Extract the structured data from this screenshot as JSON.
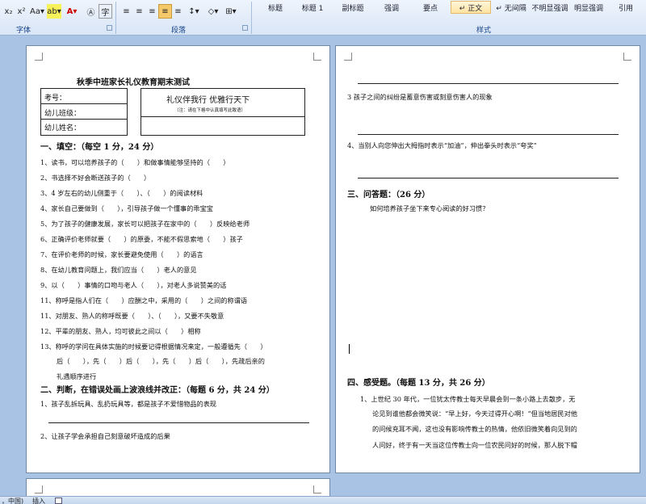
{
  "ribbon": {
    "font_group": {
      "label": "字体",
      "tools": [
        "x₂",
        "x²",
        "Aa▾",
        "ab▾",
        "A▾",
        "Ⓐ",
        "字"
      ]
    },
    "paragraph_group": {
      "label": "段落",
      "tools": [
        "≡",
        "≡",
        "≡",
        "≡",
        "≡",
        "↕▾",
        "◇▾",
        "⊞▾"
      ]
    },
    "styles_group": {
      "label": "样式",
      "items": [
        "标题",
        "标题 1",
        "副标题",
        "强调",
        "要点",
        "↵ 正文",
        "↵ 无间隔",
        "不明显强调",
        "明显强调",
        "引用"
      ],
      "active_index": 5
    }
  },
  "page1": {
    "title": "秋季中班家长礼仪教育期末测试",
    "info_left": [
      "考号：",
      "幼儿班级：",
      "幼儿姓名："
    ],
    "info_right_title": "礼仪伴我行 优雅行天下",
    "info_right_note": "（注：请在下格中认真填写此致语）",
    "section1_heading": "一、填空：（每空 1 分，24 分）",
    "section1_lines": [
      "1、读书，可以培养孩子的（　　）和做事情能够坚持的（　　）",
      "2、书选择不好会断送孩子的（　　）",
      "3、4 岁左右的幼儿侧重于（　　）、（　　）的阅读材料",
      "4、家长自己要做到（　　），引导孩子做一个懂事的乖宝宝",
      "5、为了孩子的健康发展，家长可以把孩子在家中的（　　）反映给老师",
      "6、正确评价老师就要（　　）的原委，不能不假思索地（　　）孩子",
      "7、在评价老师的时候，家长要避免使用（　　）的语言",
      "8、在幼儿教育问题上，我们应当（　　）老人的意见",
      "9、以（　　）事情的口吻与老人（　　），对老人多说赞美的话",
      "11、称呼是指人们在（　　）应酬之中，采用的（　　）之间的称谓语",
      "11、对朋友、熟人的称呼既要（　　）、（　　），又要不失敬意",
      "12、平辈的朋友、熟人，均可彼此之间以（　　）相称",
      "13、称呼的学问在具体实施的时候要记得根据情况来定，一般遵循先（　　）",
      "后（　　），先（　　）后（　　），先（　　）后（　　），先疏后亲的",
      "礼遇顺序进行"
    ],
    "section2_heading": "二、判断，在错误处画上波浪线并改正：（每题 6 分，共 24 分）",
    "section2_lines": [
      "1、孩子乱拆玩具、乱扔玩具等，都是孩子不爱惜物品的表现",
      "2、让孩子学会承担自己刻意破坏造成的后果"
    ]
  },
  "page2": {
    "lines_top": [
      "3 孩子之间的纠纷是蓄意伤害或刻意伤害人的现象",
      "4、当别人向您伸出大拇指时表示“加油”，伸出拳头时表示“夸奖”"
    ],
    "section3_heading": "三、问答题：（26 分）",
    "section3_question": "如何培养孩子坐下来专心阅读的好习惯？",
    "section4_heading": "四、感受题。（每题 13 分，共 26 分）",
    "section4_lines": [
      "1、上世纪 30 年代，一位犹太传教士每天早晨会到一条小路上去散步，无",
      "论见到谁他都会微笑说：“早上好，今天过得开心啊！”但当地居民对他",
      "的问候充耳不闻，这也没有影响传教士的热情，他依旧微笑着向见到的",
      "人问好，终于有一天当这位传教士向一位农民问好的时候，那人脱下帽"
    ]
  },
  "statusbar": {
    "language": "，中国)",
    "mode": "插入"
  }
}
